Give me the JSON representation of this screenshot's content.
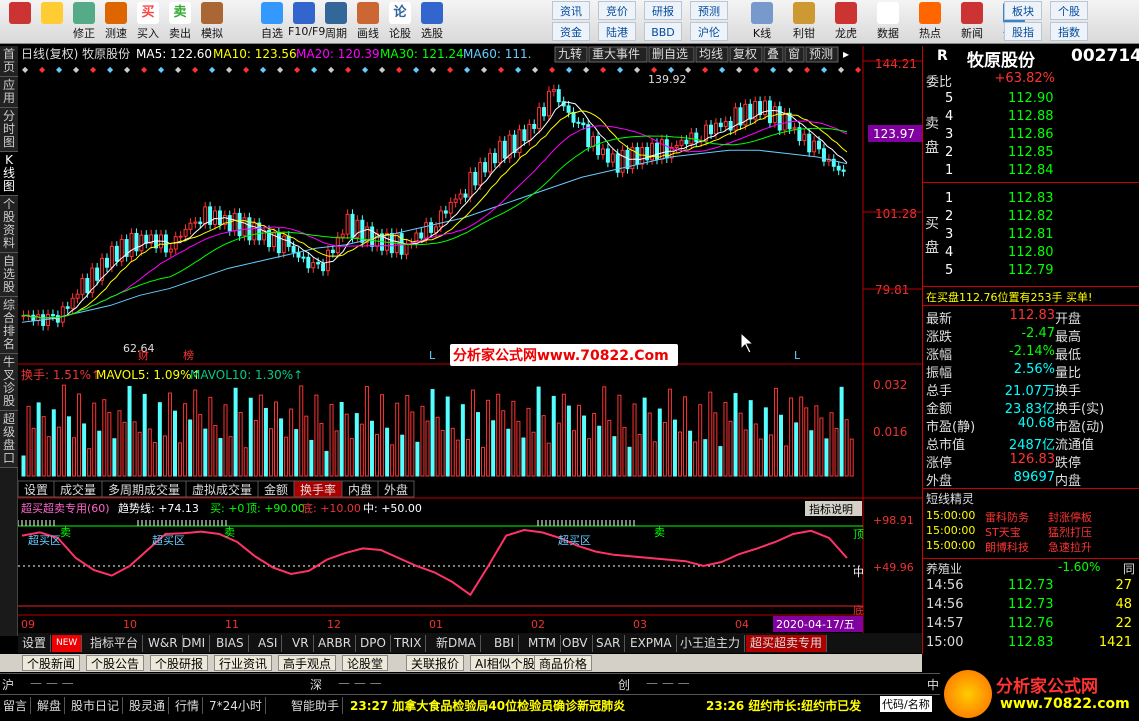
{
  "toolbar": {
    "items": [
      {
        "icon": "grid-icon",
        "label": ""
      },
      {
        "icon": "back-arrow-icon",
        "label": ""
      },
      {
        "icon": "up-down-icon",
        "label": "修正"
      },
      {
        "icon": "clock-icon",
        "label": "测速"
      },
      {
        "icon": "buy-icon",
        "glyph": "买",
        "label": "买入"
      },
      {
        "icon": "sell-icon",
        "glyph": "卖",
        "label": "卖出"
      },
      {
        "icon": "hammer-icon",
        "label": "模拟"
      },
      {
        "icon": "star-icon",
        "label": "自选"
      },
      {
        "icon": "f10-icon",
        "label": "F10/F9"
      },
      {
        "icon": "period-icon",
        "label": "周期"
      },
      {
        "icon": "pen-icon",
        "label": "画线"
      },
      {
        "icon": "stock-icon",
        "glyph": "论",
        "label": "论股"
      },
      {
        "icon": "search-icon",
        "label": "选股"
      }
    ],
    "links": [
      "资讯",
      "资金",
      "竞价",
      "陆港",
      "研报",
      "BBD",
      "预测",
      "沪伦"
    ],
    "items2": [
      {
        "icon": "kline-icon",
        "label": "K线"
      },
      {
        "icon": "chart-icon",
        "label": "利钳"
      },
      {
        "icon": "dragon-icon",
        "label": "龙虎"
      },
      {
        "icon": "pe-icon",
        "label": "数据"
      },
      {
        "icon": "hot-icon",
        "label": "热点"
      },
      {
        "icon": "news-icon",
        "label": "新闻"
      },
      {
        "icon": "globe-icon",
        "label": "全球"
      }
    ],
    "links2": [
      "板块",
      "股指",
      "个股",
      "指数"
    ]
  },
  "leftbar": [
    "首页",
    "应用",
    "分时图",
    "K线图",
    "个股资料",
    "自选股",
    "综合排名",
    "牛叉诊股",
    "超级盘口"
  ],
  "header": {
    "stock": "日线(复权) 牧原股份",
    "ma5": "MA5: 122.60",
    "ma10": "MA10: 123.56",
    "ma20": "MA20: 120.39",
    "ma30": "MA30: 121.24",
    "ma60": "MA60: 111.",
    "buttons": [
      "九转",
      "重大事件",
      "删自选",
      "均线",
      "复权",
      "叠",
      "窗",
      "预测"
    ]
  },
  "price_axis": [
    "144.21",
    "123.97",
    "101.28",
    "79.81"
  ],
  "annot": {
    "high": "139.92",
    "low": "62.64",
    "cai": "财",
    "bang": "榜",
    "l1": "L",
    "l2": "L"
  },
  "watermark": "分析家公式网www.70822.Com",
  "vol_header": {
    "a": "换手: 1.51%↑",
    "b": "MAVOL5: 1.09%↑",
    "c": "MAVOL10: 1.30%↑"
  },
  "vol_axis": [
    "0.032",
    "0.016"
  ],
  "vol_tabs": [
    "设置",
    "成交量",
    "多周期成交量",
    "虚拟成交量",
    "金额",
    "换手率",
    "内盘",
    "外盘"
  ],
  "osc_header": {
    "name": "超买超卖专用(60)",
    "trend": "趋势线: +74.13",
    "buy": "买: +0",
    "top": "顶: +90.00",
    "bottom": "底: +10.00",
    "mid": "中: +50.00",
    "btn": "指标说明"
  },
  "osc_axis": [
    "+98.91",
    "+49.96"
  ],
  "osc_labels": {
    "ob1": "超买区",
    "ob2": "超买区",
    "ob3": "超买区",
    "sell1": "卖",
    "sell2": "卖",
    "sell3": "卖",
    "top": "顶",
    "mid": "中",
    "bottom": "底"
  },
  "months": [
    "09",
    "10",
    "11",
    "12",
    "01",
    "02",
    "03",
    "04"
  ],
  "date_hl": "2020-04-17/五",
  "ind_tabs": [
    "设置",
    "NEW",
    "指标平台",
    "W&R",
    "DMI",
    "BIAS",
    "ASI",
    "VR",
    "ARBR",
    "DPO",
    "TRIX",
    "新DMA",
    "BBI",
    "MTM",
    "OBV",
    "SAR",
    "EXPMA",
    "小王追主力",
    "超买超卖专用"
  ],
  "bottom_tabs": [
    "个股新闻",
    "个股公告",
    "个股研报",
    "行业资讯",
    "高手观点",
    "论股堂",
    "关联报价",
    "AI相似个股",
    "商品价格"
  ],
  "right": {
    "r": "R",
    "name": "牧原股份",
    "code": "002714",
    "weibi_l": "委比",
    "weibi_v": "+63.82%",
    "sell": [
      [
        "5",
        "112.90"
      ],
      [
        "4",
        "112.88"
      ],
      [
        "3",
        "112.86"
      ],
      [
        "2",
        "112.85"
      ],
      [
        "1",
        "112.84"
      ]
    ],
    "sell_label": "卖盘",
    "buy": [
      [
        "1",
        "112.83"
      ],
      [
        "2",
        "112.82"
      ],
      [
        "3",
        "112.81"
      ],
      [
        "4",
        "112.80"
      ],
      [
        "5",
        "112.79"
      ]
    ],
    "buy_label": "买盘",
    "notice": "在买盘112.76位置有253手 买单!",
    "stats": [
      [
        "最新",
        "112.83",
        "开盘"
      ],
      [
        "涨跌",
        "-2.47",
        "最高"
      ],
      [
        "涨幅",
        "-2.14%",
        "最低"
      ],
      [
        "振幅",
        "2.56%",
        "量比"
      ],
      [
        "总手",
        "21.07万",
        "换手"
      ],
      [
        "金额",
        "23.83亿",
        "换手(实)"
      ],
      [
        "市盈(静)",
        "40.68",
        "市盈(动)"
      ],
      [
        "总市值",
        "2487亿",
        "流通值"
      ],
      [
        "涨停",
        "126.83",
        "跌停"
      ],
      [
        "外盘",
        "89697",
        "内盘"
      ]
    ],
    "elf": "短线精灵",
    "elf_rows": [
      [
        "15:00:00",
        "雷科防务",
        "封涨停板"
      ],
      [
        "15:00:00",
        "ST天宝",
        "猛烈打压"
      ],
      [
        "15:00:00",
        "朗博科技",
        "急速拉升"
      ]
    ],
    "industry": "养殖业",
    "industry_chg": "-1.60%",
    "tong": "同",
    "ticks": [
      [
        "14:56",
        "112.73",
        "27"
      ],
      [
        "14:56",
        "112.73",
        "48"
      ],
      [
        "14:57",
        "112.76",
        "22"
      ],
      [
        "15:00",
        "112.83",
        "1421"
      ]
    ]
  },
  "status": {
    "sh": "沪",
    "sz": "深",
    "cy": "创",
    "zhong": "中",
    "items": [
      "留言",
      "解盘",
      "股市日记",
      "股灵通",
      "行情",
      "7*24小时",
      "智能助手"
    ],
    "news1": "23:27 加拿大食品检验局40位检验员确诊新冠肺炎",
    "news2": "23:26 纽约市长:纽约市已发",
    "code": "代码/名称",
    "logo": "分析家公式网",
    "logo_url": "www.70822.com"
  },
  "chart_data": {
    "type": "candlestick",
    "title": "日线(复权) 牧原股份",
    "x": [
      "09",
      "10",
      "11",
      "12",
      "01",
      "02",
      "03",
      "04"
    ],
    "close": [
      72,
      70,
      80,
      90,
      95,
      93,
      102,
      100,
      96,
      92,
      85,
      99,
      94,
      93,
      100,
      110,
      120,
      125,
      138,
      126,
      117,
      120,
      122,
      126,
      130,
      134,
      128,
      120,
      113
    ],
    "ma60": [
      70,
      71,
      73,
      75,
      78,
      80,
      83,
      86,
      88,
      90,
      92,
      93,
      95,
      97,
      99,
      101,
      104,
      107,
      110,
      113,
      115,
      117,
      119,
      120,
      121,
      121,
      120,
      119,
      117
    ],
    "ylim": [
      60,
      146
    ]
  }
}
